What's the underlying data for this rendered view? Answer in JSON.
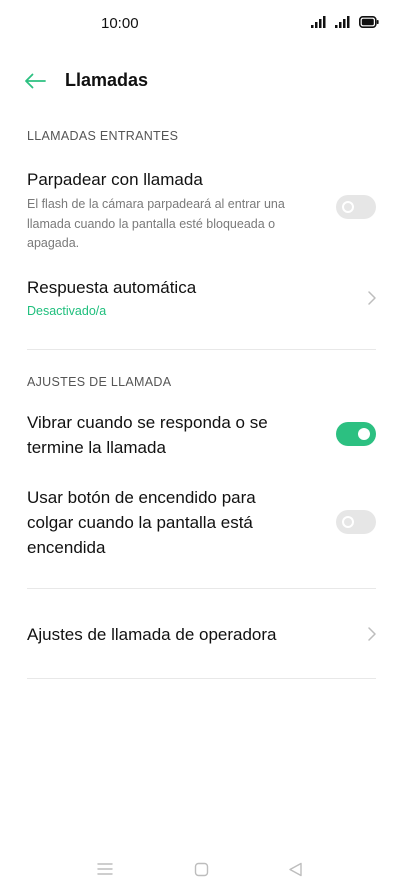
{
  "status_bar": {
    "time": "10:00"
  },
  "header": {
    "title": "Llamadas"
  },
  "sections": {
    "incoming_header": "LLAMADAS ENTRANTES",
    "settings_header": "AJUSTES DE LLAMADA"
  },
  "rows": {
    "flash": {
      "title": "Parpadear con llamada",
      "description_line1": "El flash de la cámara parpadeará al entrar una",
      "description_line2": "llamada cuando la pantalla esté bloqueada o",
      "description_line3": "apagada.",
      "enabled": false
    },
    "auto_answer": {
      "title": "Respuesta automática",
      "status": "Desactivado/a"
    },
    "vibrate": {
      "title_line1": "Vibrar cuando se responda o se",
      "title_line2": "termine la llamada",
      "enabled": true
    },
    "power_hangup": {
      "title_line1": "Usar botón de encendido para",
      "title_line2": "colgar cuando la pantalla está",
      "title_line3": "encendida",
      "enabled": false
    },
    "operator": {
      "title": "Ajustes de llamada de operadora"
    }
  },
  "colors": {
    "accent": "#2cc081",
    "toggle_off": "#e6e6e6",
    "secondary_text": "#7a7a7a"
  },
  "icons": {
    "back": "arrow-left-icon",
    "chevron": "chevron-right-icon",
    "signal": "cell-signal-icon",
    "battery": "battery-icon",
    "nav_menu": "menu-icon",
    "nav_home": "home-square-icon",
    "nav_back": "back-triangle-icon"
  }
}
